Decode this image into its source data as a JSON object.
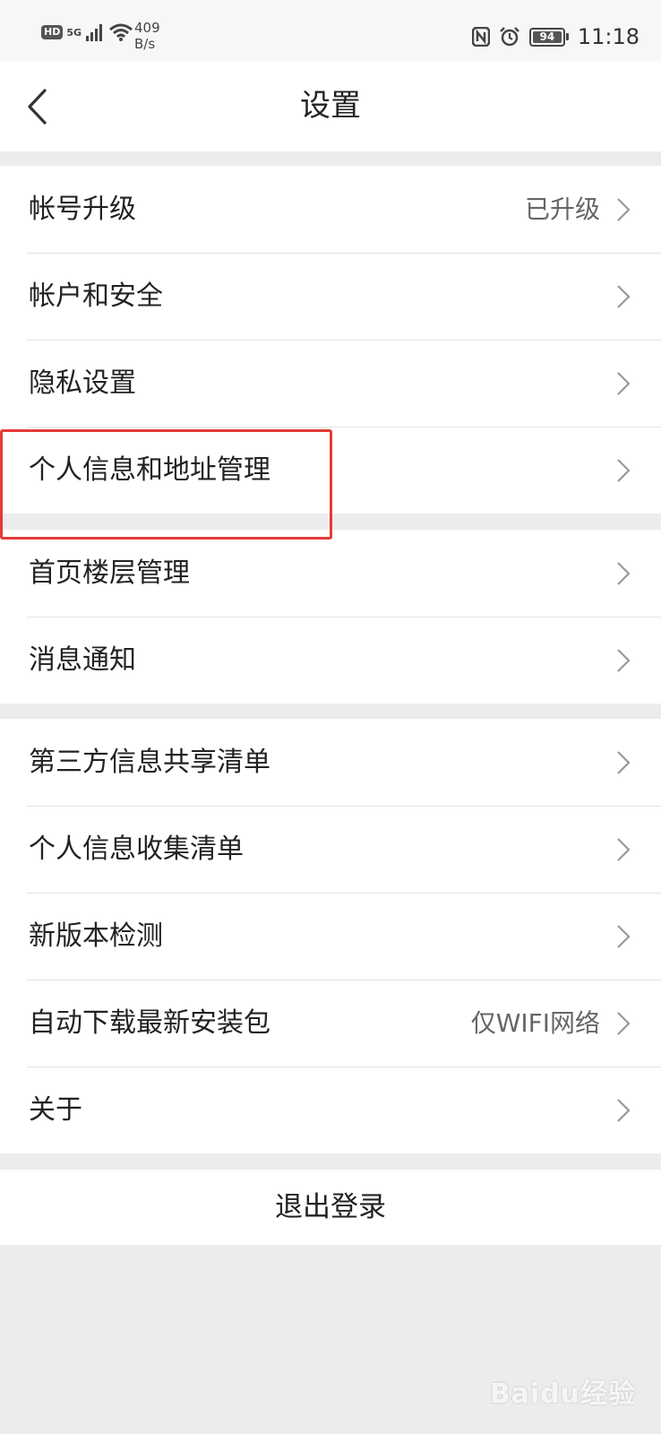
{
  "status_bar": {
    "hd": "HD",
    "network": "5G",
    "speed_value": "409",
    "speed_unit": "B/s",
    "battery": "94",
    "time": "11:18",
    "icons": [
      "signal-icon",
      "wifi-icon",
      "nfc-icon",
      "alarm-icon",
      "battery-icon"
    ]
  },
  "nav": {
    "title": "设置",
    "back_icon": "chevron-left-icon"
  },
  "groups": [
    [
      {
        "label": "帐号升级",
        "value": "已升级"
      },
      {
        "label": "帐户和安全",
        "value": ""
      },
      {
        "label": "隐私设置",
        "value": ""
      },
      {
        "label": "个人信息和地址管理",
        "value": ""
      }
    ],
    [
      {
        "label": "首页楼层管理",
        "value": ""
      },
      {
        "label": "消息通知",
        "value": ""
      }
    ],
    [
      {
        "label": "第三方信息共享清单",
        "value": ""
      },
      {
        "label": "个人信息收集清单",
        "value": ""
      },
      {
        "label": "新版本检测",
        "value": ""
      },
      {
        "label": "自动下载最新安装包",
        "value": "仅WIFI网络"
      },
      {
        "label": "关于",
        "value": ""
      }
    ]
  ],
  "logout_label": "退出登录",
  "watermark": "Baidu经验",
  "colors": {
    "highlight": "#e53935",
    "background": "#ececec"
  }
}
